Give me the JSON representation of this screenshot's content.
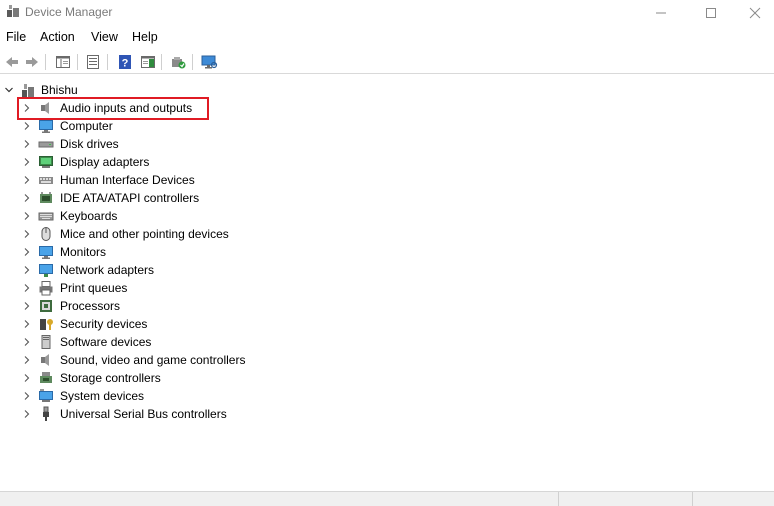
{
  "window": {
    "title": "Device Manager",
    "icon": "device-manager-icon",
    "controls": [
      "minimize-icon",
      "maximize-icon",
      "close-icon"
    ]
  },
  "menu": {
    "file": "File",
    "action": "Action",
    "view": "View",
    "help": "Help"
  },
  "toolbar": {
    "buttons": [
      "back-arrow-icon",
      "forward-arrow-icon",
      "show-hide-console-tree-icon",
      "properties-icon",
      "help-icon",
      "action-pane-icon",
      "update-driver-icon",
      "scan-hardware-icon"
    ]
  },
  "tree": {
    "root": {
      "label": "Bhishu",
      "icon": "computer-icon",
      "expanded": true
    },
    "items": [
      {
        "label": "Audio inputs and outputs",
        "icon": "speaker-icon"
      },
      {
        "label": "Computer",
        "icon": "monitor-icon"
      },
      {
        "label": "Disk drives",
        "icon": "disk-drive-icon"
      },
      {
        "label": "Display adapters",
        "icon": "display-adapter-icon"
      },
      {
        "label": "Human Interface Devices",
        "icon": "hid-icon"
      },
      {
        "label": "IDE ATA/ATAPI controllers",
        "icon": "ide-controller-icon"
      },
      {
        "label": "Keyboards",
        "icon": "keyboard-icon"
      },
      {
        "label": "Mice and other pointing devices",
        "icon": "mouse-icon"
      },
      {
        "label": "Monitors",
        "icon": "monitor-icon"
      },
      {
        "label": "Network adapters",
        "icon": "network-adapter-icon"
      },
      {
        "label": "Print queues",
        "icon": "printer-icon"
      },
      {
        "label": "Processors",
        "icon": "processor-icon"
      },
      {
        "label": "Security devices",
        "icon": "security-device-icon"
      },
      {
        "label": "Software devices",
        "icon": "software-device-icon"
      },
      {
        "label": "Sound, video and game controllers",
        "icon": "speaker-icon"
      },
      {
        "label": "Storage controllers",
        "icon": "storage-controller-icon"
      },
      {
        "label": "System devices",
        "icon": "system-device-icon"
      },
      {
        "label": "Universal Serial Bus controllers",
        "icon": "usb-icon"
      }
    ]
  },
  "colors": {
    "highlight_border": "#e01b24",
    "toolbar_blue": "#2f6fbf"
  }
}
